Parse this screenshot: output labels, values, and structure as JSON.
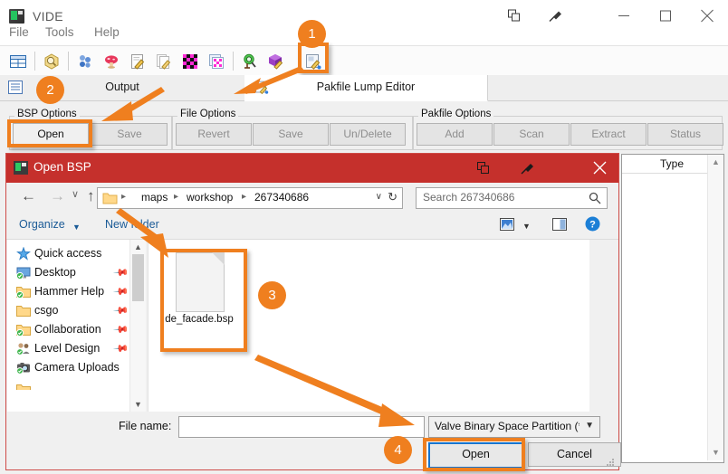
{
  "app": {
    "title": "VIDE",
    "menu": [
      "File",
      "Tools",
      "Help"
    ],
    "titlebar_buttons": [
      "restore-pane-icon",
      "pin-icon",
      "minimize-icon",
      "maximize-icon",
      "close-icon"
    ]
  },
  "toolbar": {
    "icons": [
      "grid-layout-icon",
      "hex-search-icon",
      "blue-spheres-icon",
      "mushroom-icon",
      "edit-document-icon",
      "copy-document-icon",
      "checker-texture-icon",
      "texture-stack-icon",
      "entity-search-icon",
      "cubemap-edit-icon",
      "pakfile-lump-editor-icon"
    ]
  },
  "tabs": [
    {
      "label": "Output",
      "icon": "list-icon",
      "active": false
    },
    {
      "label": "Pakfile Lump Editor",
      "icon": "pakfile-lump-editor-icon",
      "active": true
    }
  ],
  "options": {
    "bsp": {
      "title": "BSP Options",
      "buttons": [
        {
          "label": "Open",
          "enabled": true
        },
        {
          "label": "Save",
          "enabled": false
        }
      ]
    },
    "file": {
      "title": "File Options",
      "buttons": [
        {
          "label": "Revert",
          "enabled": false
        },
        {
          "label": "Save",
          "enabled": false
        },
        {
          "label": "Un/Delete",
          "enabled": false
        }
      ]
    },
    "pakfile": {
      "title": "Pakfile Options",
      "buttons": [
        {
          "label": "Add",
          "enabled": false
        },
        {
          "label": "Scan",
          "enabled": false
        },
        {
          "label": "Extract",
          "enabled": false
        },
        {
          "label": "Status",
          "enabled": false
        }
      ]
    }
  },
  "right_panel": {
    "column_header": "Type"
  },
  "dialog": {
    "title": "Open BSP",
    "titlebar_buttons": [
      "restore-pane-icon",
      "pin-icon",
      "close-icon"
    ],
    "nav": {
      "back": "←",
      "forward": "→",
      "recent": "∨",
      "up": "↑",
      "breadcrumbs": [
        "maps",
        "workshop",
        "267340686"
      ],
      "dropdown": "∨",
      "refresh": "↻",
      "search_placeholder": "Search 267340686",
      "search_icon": "magnifier-icon"
    },
    "commandbar": {
      "organize": "Organize",
      "new_folder": "New folder",
      "view_icon": "view-layout-icon",
      "preview_icon": "preview-pane-icon",
      "help_icon": "help-icon"
    },
    "sidebar": [
      {
        "label": "Quick access",
        "icon": "quick-access-star-icon",
        "pinned": false
      },
      {
        "label": "Desktop",
        "icon": "desktop-icon",
        "pinned": true
      },
      {
        "label": "Hammer Help",
        "icon": "folder-sync-icon",
        "pinned": true
      },
      {
        "label": "csgo",
        "icon": "folder-icon",
        "pinned": true
      },
      {
        "label": "Collaboration",
        "icon": "folder-sync-icon",
        "pinned": true
      },
      {
        "label": "Level Design",
        "icon": "people-sync-icon",
        "pinned": true
      },
      {
        "label": "Camera Uploads",
        "icon": "camera-sync-icon",
        "pinned": false
      }
    ],
    "files": [
      {
        "name": "de_facade.bsp",
        "icon": "generic-file-icon",
        "selected": true
      }
    ],
    "footer": {
      "filename_label": "File name:",
      "filename_value": "",
      "filetype_value": "Valve Binary Space Partition (*.b",
      "open_button": "Open",
      "cancel_button": "Cancel"
    }
  },
  "annotations": {
    "accent_color": "#ef7f1f",
    "badges": [
      {
        "number": "1",
        "target": "pakfile-lump-editor-toolbar-icon"
      },
      {
        "number": "2",
        "target": "bsp-options-open-button"
      },
      {
        "number": "3",
        "target": "de_facade.bsp file"
      },
      {
        "number": "4",
        "target": "dialog-open-button"
      }
    ]
  }
}
